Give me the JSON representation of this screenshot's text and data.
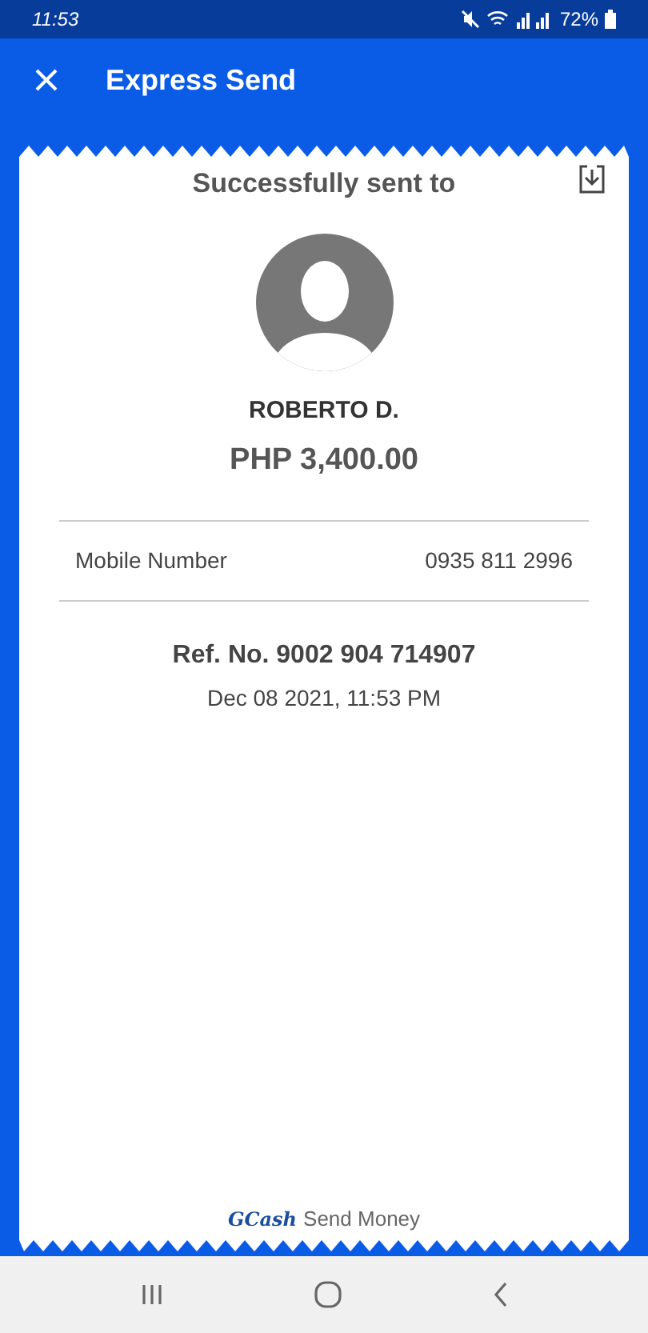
{
  "status_bar": {
    "time": "11:53",
    "battery": "72%"
  },
  "header": {
    "title": "Express Send"
  },
  "receipt": {
    "heading": "Successfully sent to",
    "name": "ROBERTO D.",
    "amount": "PHP 3,400.00",
    "details": [
      {
        "label": "Mobile Number",
        "value": "0935 811 2996"
      }
    ],
    "reference": "Ref. No. 9002 904 714907",
    "date": "Dec 08 2021, 11:53 PM",
    "footer": {
      "brand": "GCash",
      "text": "Send Money"
    }
  }
}
